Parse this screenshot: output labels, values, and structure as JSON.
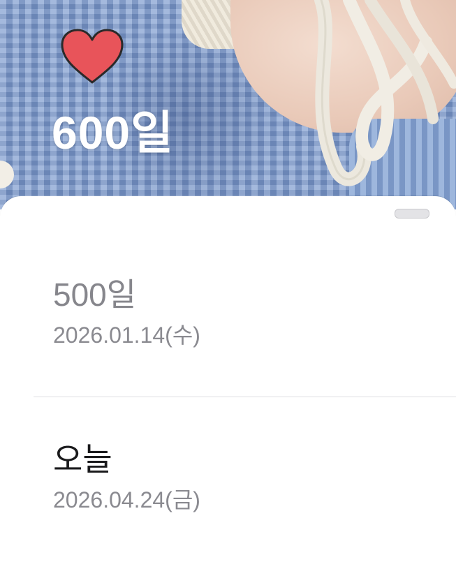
{
  "header": {
    "dday_label": "600일"
  },
  "icons": {
    "heart": "heart-icon"
  },
  "colors": {
    "heart": "#e8545a",
    "title_text": "#ffffff",
    "past_label": "#86868c",
    "current_label": "#1a1a1c",
    "date_text": "#8a8a90"
  },
  "milestones": [
    {
      "label": "500일",
      "date": "2026.01.14(수)"
    },
    {
      "label": "오늘",
      "date": "2026.04.24(금)"
    }
  ]
}
